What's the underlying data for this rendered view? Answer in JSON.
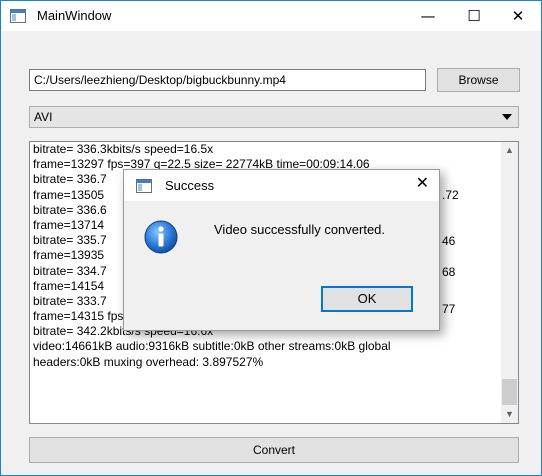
{
  "window": {
    "title": "MainWindow",
    "minimize": "—",
    "maximize": "☐",
    "close": "✕"
  },
  "file": {
    "path": "C:/Users/leezhieng/Desktop/bigbuckbunny.mp4",
    "browse_label": "Browse"
  },
  "format": {
    "selected": "AVI"
  },
  "log": {
    "lines": [
      "bitrate= 336.3kbits/s speed=16.5x",
      "frame=13297 fps=397 q=22.5 size=    22774kB time=00:09:14.06",
      "bitrate= 336.7",
      "frame=13505",
      "bitrate= 336.6",
      "frame=13714",
      "bitrate= 335.7",
      "frame=13935",
      "bitrate= 334.7",
      "frame=14154",
      "bitrate= 333.7",
      "frame=14315 fps=399 q=4.9 Lsize=    24912kB time=00:09:56.45",
      "bitrate= 342.2kbits/s speed=16.6x",
      "video:14661kB audio:9316kB subtitle:0kB other streams:0kB global",
      "headers:0kB muxing overhead: 3.897527%"
    ],
    "right_fragments": [
      ".72",
      "46",
      "68",
      "77"
    ]
  },
  "convert_label": "Convert",
  "dialog": {
    "title": "Success",
    "message": "Video successfully converted.",
    "ok_label": "OK",
    "close": "✕"
  },
  "colors": {
    "accent": "#0078d7",
    "info_icon": "#1c6fd1"
  }
}
